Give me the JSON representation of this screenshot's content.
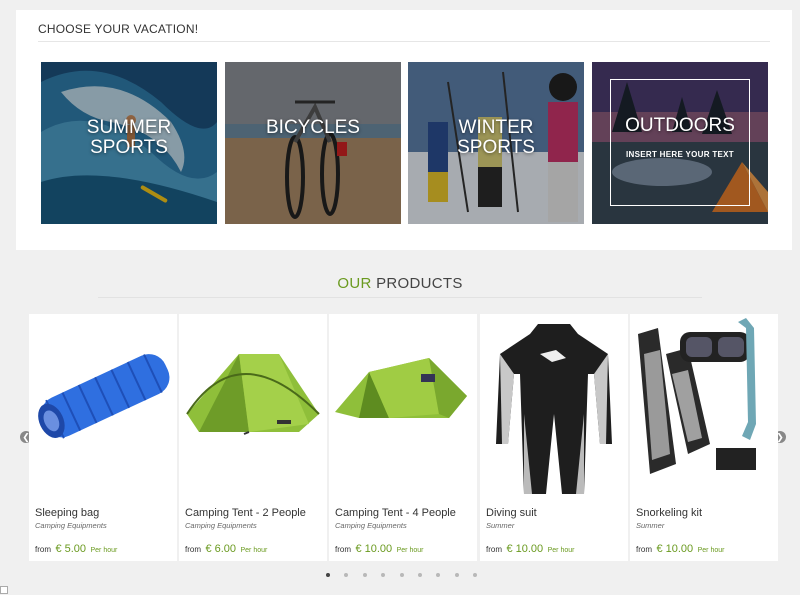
{
  "vacation": {
    "title": "CHOOSE YOUR VACATION!",
    "tiles": [
      {
        "line1": "SUMMER",
        "line2": "SPORTS"
      },
      {
        "line1": "BICYCLES",
        "line2": ""
      },
      {
        "line1": "WINTER",
        "line2": "SPORTS"
      },
      {
        "line1": "OUTDOORS",
        "line2": "",
        "subtitle": "INSERT HERE YOUR TEXT"
      }
    ]
  },
  "products": {
    "heading_our": "OUR",
    "heading_products": "PRODUCTS",
    "items": [
      {
        "name": "Sleeping bag",
        "category": "Camping Equipments",
        "from": "from",
        "price": "€ 5.00",
        "per": "Per hour"
      },
      {
        "name": "Camping Tent - 2 People",
        "category": "Camping Equipments",
        "from": "from",
        "price": "€ 6.00",
        "per": "Per hour"
      },
      {
        "name": "Camping Tent - 4 People",
        "category": "Camping Equipments",
        "from": "from",
        "price": "€ 10.00",
        "per": "Per hour"
      },
      {
        "name": "Diving suit",
        "category": "Summer",
        "from": "from",
        "price": "€ 10.00",
        "per": "Per hour"
      },
      {
        "name": "Snorkeling kit",
        "category": "Summer",
        "from": "from",
        "price": "€ 10.00",
        "per": "Per hour"
      }
    ],
    "carousel": {
      "prev_icon": "chevron-left-icon",
      "next_icon": "chevron-right-icon",
      "pages": 9,
      "active_page": 1
    }
  },
  "colors": {
    "accent": "#6a9a1f",
    "page_bg": "#f0f0f0"
  }
}
